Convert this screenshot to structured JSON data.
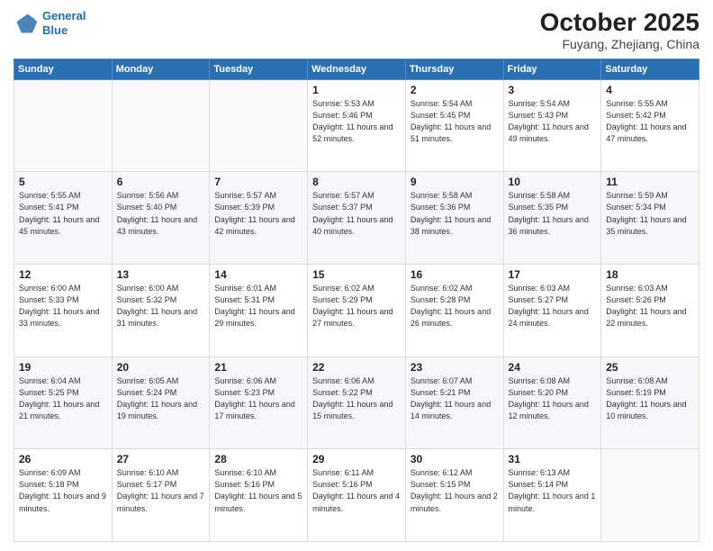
{
  "header": {
    "logo_line1": "General",
    "logo_line2": "Blue",
    "title": "October 2025",
    "subtitle": "Fuyang, Zhejiang, China"
  },
  "weekdays": [
    "Sunday",
    "Monday",
    "Tuesday",
    "Wednesday",
    "Thursday",
    "Friday",
    "Saturday"
  ],
  "weeks": [
    [
      {
        "day": "",
        "info": ""
      },
      {
        "day": "",
        "info": ""
      },
      {
        "day": "",
        "info": ""
      },
      {
        "day": "1",
        "info": "Sunrise: 5:53 AM\nSunset: 5:46 PM\nDaylight: 11 hours\nand 52 minutes."
      },
      {
        "day": "2",
        "info": "Sunrise: 5:54 AM\nSunset: 5:45 PM\nDaylight: 11 hours\nand 51 minutes."
      },
      {
        "day": "3",
        "info": "Sunrise: 5:54 AM\nSunset: 5:43 PM\nDaylight: 11 hours\nand 49 minutes."
      },
      {
        "day": "4",
        "info": "Sunrise: 5:55 AM\nSunset: 5:42 PM\nDaylight: 11 hours\nand 47 minutes."
      }
    ],
    [
      {
        "day": "5",
        "info": "Sunrise: 5:55 AM\nSunset: 5:41 PM\nDaylight: 11 hours\nand 45 minutes."
      },
      {
        "day": "6",
        "info": "Sunrise: 5:56 AM\nSunset: 5:40 PM\nDaylight: 11 hours\nand 43 minutes."
      },
      {
        "day": "7",
        "info": "Sunrise: 5:57 AM\nSunset: 5:39 PM\nDaylight: 11 hours\nand 42 minutes."
      },
      {
        "day": "8",
        "info": "Sunrise: 5:57 AM\nSunset: 5:37 PM\nDaylight: 11 hours\nand 40 minutes."
      },
      {
        "day": "9",
        "info": "Sunrise: 5:58 AM\nSunset: 5:36 PM\nDaylight: 11 hours\nand 38 minutes."
      },
      {
        "day": "10",
        "info": "Sunrise: 5:58 AM\nSunset: 5:35 PM\nDaylight: 11 hours\nand 36 minutes."
      },
      {
        "day": "11",
        "info": "Sunrise: 5:59 AM\nSunset: 5:34 PM\nDaylight: 11 hours\nand 35 minutes."
      }
    ],
    [
      {
        "day": "12",
        "info": "Sunrise: 6:00 AM\nSunset: 5:33 PM\nDaylight: 11 hours\nand 33 minutes."
      },
      {
        "day": "13",
        "info": "Sunrise: 6:00 AM\nSunset: 5:32 PM\nDaylight: 11 hours\nand 31 minutes."
      },
      {
        "day": "14",
        "info": "Sunrise: 6:01 AM\nSunset: 5:31 PM\nDaylight: 11 hours\nand 29 minutes."
      },
      {
        "day": "15",
        "info": "Sunrise: 6:02 AM\nSunset: 5:29 PM\nDaylight: 11 hours\nand 27 minutes."
      },
      {
        "day": "16",
        "info": "Sunrise: 6:02 AM\nSunset: 5:28 PM\nDaylight: 11 hours\nand 26 minutes."
      },
      {
        "day": "17",
        "info": "Sunrise: 6:03 AM\nSunset: 5:27 PM\nDaylight: 11 hours\nand 24 minutes."
      },
      {
        "day": "18",
        "info": "Sunrise: 6:03 AM\nSunset: 5:26 PM\nDaylight: 11 hours\nand 22 minutes."
      }
    ],
    [
      {
        "day": "19",
        "info": "Sunrise: 6:04 AM\nSunset: 5:25 PM\nDaylight: 11 hours\nand 21 minutes."
      },
      {
        "day": "20",
        "info": "Sunrise: 6:05 AM\nSunset: 5:24 PM\nDaylight: 11 hours\nand 19 minutes."
      },
      {
        "day": "21",
        "info": "Sunrise: 6:06 AM\nSunset: 5:23 PM\nDaylight: 11 hours\nand 17 minutes."
      },
      {
        "day": "22",
        "info": "Sunrise: 6:06 AM\nSunset: 5:22 PM\nDaylight: 11 hours\nand 15 minutes."
      },
      {
        "day": "23",
        "info": "Sunrise: 6:07 AM\nSunset: 5:21 PM\nDaylight: 11 hours\nand 14 minutes."
      },
      {
        "day": "24",
        "info": "Sunrise: 6:08 AM\nSunset: 5:20 PM\nDaylight: 11 hours\nand 12 minutes."
      },
      {
        "day": "25",
        "info": "Sunrise: 6:08 AM\nSunset: 5:19 PM\nDaylight: 11 hours\nand 10 minutes."
      }
    ],
    [
      {
        "day": "26",
        "info": "Sunrise: 6:09 AM\nSunset: 5:18 PM\nDaylight: 11 hours\nand 9 minutes."
      },
      {
        "day": "27",
        "info": "Sunrise: 6:10 AM\nSunset: 5:17 PM\nDaylight: 11 hours\nand 7 minutes."
      },
      {
        "day": "28",
        "info": "Sunrise: 6:10 AM\nSunset: 5:16 PM\nDaylight: 11 hours\nand 5 minutes."
      },
      {
        "day": "29",
        "info": "Sunrise: 6:11 AM\nSunset: 5:16 PM\nDaylight: 11 hours\nand 4 minutes."
      },
      {
        "day": "30",
        "info": "Sunrise: 6:12 AM\nSunset: 5:15 PM\nDaylight: 11 hours\nand 2 minutes."
      },
      {
        "day": "31",
        "info": "Sunrise: 6:13 AM\nSunset: 5:14 PM\nDaylight: 11 hours\nand 1 minute."
      },
      {
        "day": "",
        "info": ""
      }
    ]
  ]
}
